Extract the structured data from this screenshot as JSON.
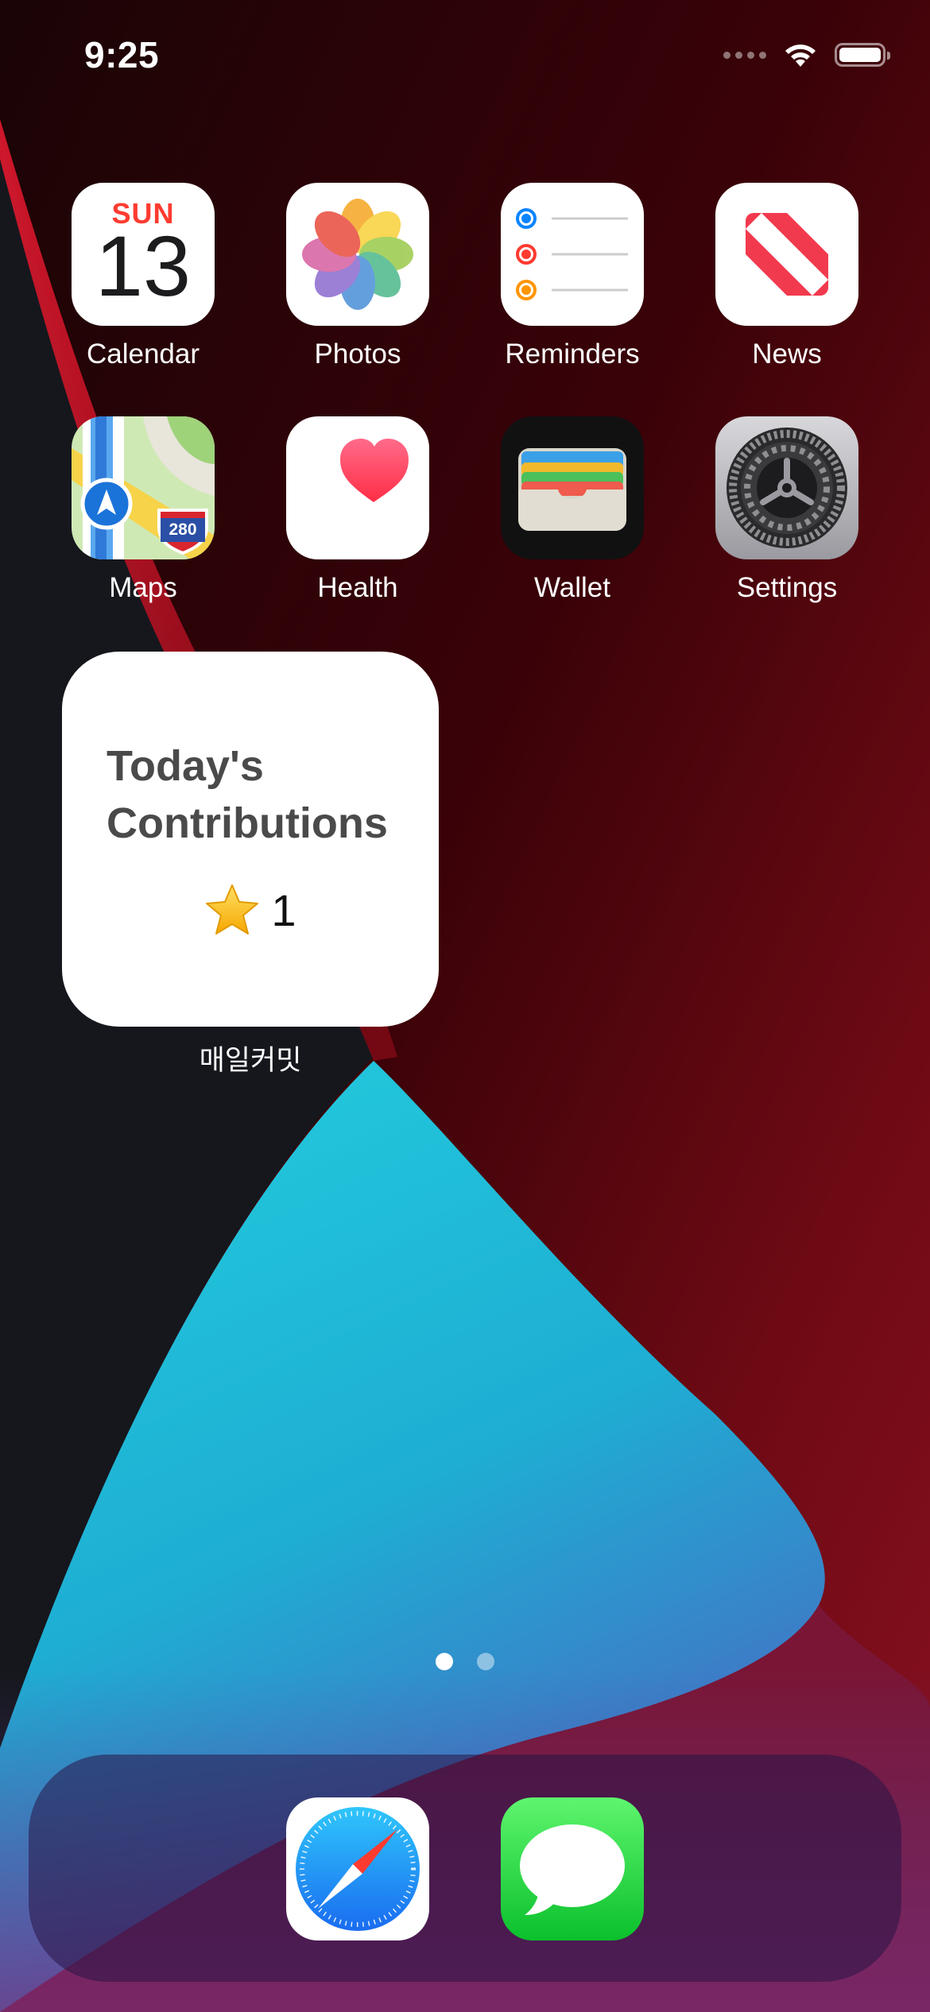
{
  "status_bar": {
    "time": "9:25"
  },
  "apps": [
    {
      "id": "calendar",
      "label": "Calendar",
      "icon": "calendar-icon",
      "day": "SUN",
      "date": "13"
    },
    {
      "id": "photos",
      "label": "Photos",
      "icon": "photos-icon"
    },
    {
      "id": "reminders",
      "label": "Reminders",
      "icon": "reminders-icon"
    },
    {
      "id": "news",
      "label": "News",
      "icon": "news-icon"
    },
    {
      "id": "maps",
      "label": "Maps",
      "icon": "maps-icon",
      "badge": "280"
    },
    {
      "id": "health",
      "label": "Health",
      "icon": "heart-icon"
    },
    {
      "id": "wallet",
      "label": "Wallet",
      "icon": "wallet-icon"
    },
    {
      "id": "settings",
      "label": "Settings",
      "icon": "gear-icon"
    }
  ],
  "widget": {
    "title": "Today's Contributions",
    "star_icon": "star-icon",
    "count": "1",
    "app_name": "매일커밋"
  },
  "page_indicator": {
    "current": 1,
    "total": 2
  },
  "dock": [
    {
      "id": "safari",
      "icon": "compass-icon"
    },
    {
      "id": "messages",
      "icon": "speech-bubble-icon"
    }
  ],
  "colors": {
    "calendar_red": "#ff3b30",
    "wallpaper_red": "#c8102e",
    "wallpaper_cyan": "#1fc3d6",
    "wallpaper_dark": "#14161c"
  }
}
